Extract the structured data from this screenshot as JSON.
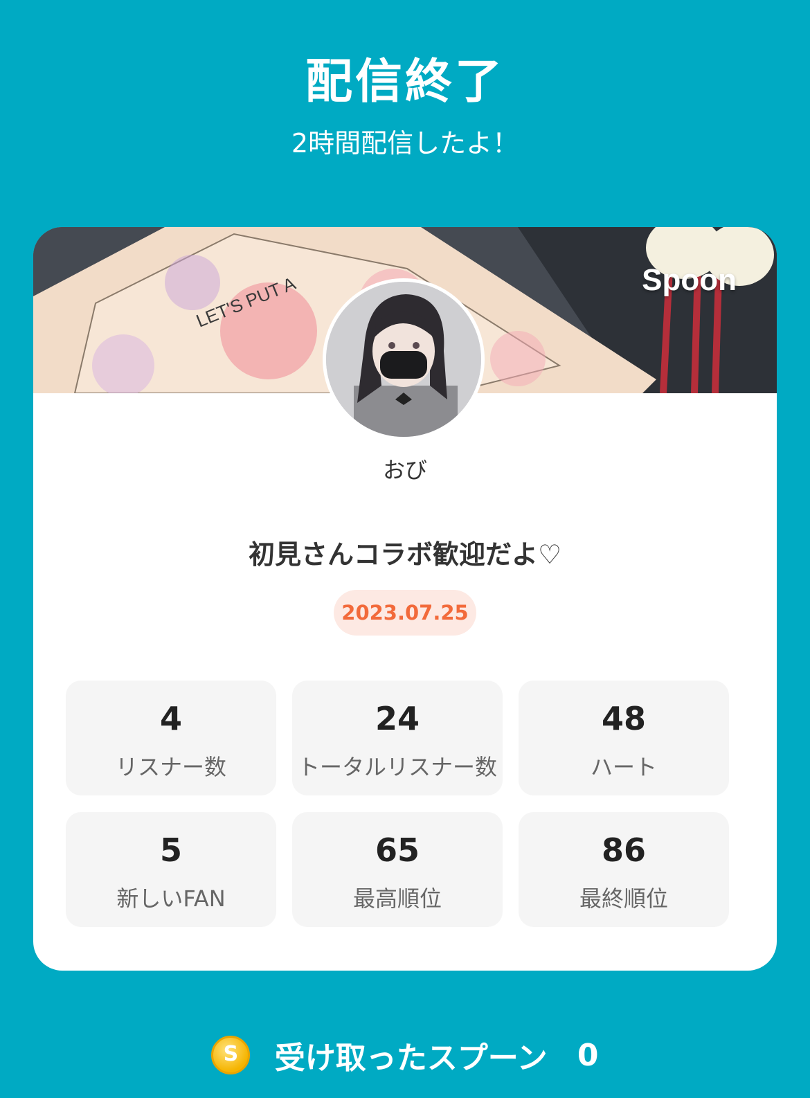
{
  "header": {
    "title": "配信終了",
    "subtitle": "2時間配信したよ！"
  },
  "card": {
    "brand": "Spoon",
    "username": "おび",
    "stream_title": "初見さんコラボ歓迎だよ♡",
    "date": "2023.07.25",
    "stats": [
      {
        "value": "4",
        "label": "リスナー数"
      },
      {
        "value": "24",
        "label": "トータルリスナー数"
      },
      {
        "value": "48",
        "label": "ハート"
      },
      {
        "value": "5",
        "label": "新しいFAN"
      },
      {
        "value": "65",
        "label": "最高順位"
      },
      {
        "value": "86",
        "label": "最終順位"
      }
    ]
  },
  "footer": {
    "coin_symbol": "S",
    "spoon_label": "受け取ったスプーン",
    "spoon_count": "0"
  },
  "colors": {
    "background": "#00aac3",
    "date_text": "#f26a3b",
    "date_bg": "#fde9e3",
    "coin": "#f5b400"
  }
}
